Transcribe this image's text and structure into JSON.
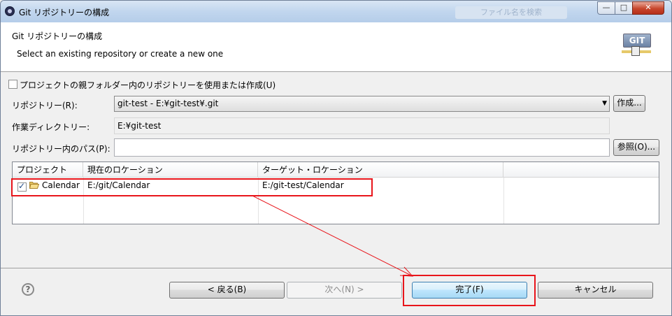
{
  "window": {
    "title": "Git リポジトリーの構成",
    "search_hint": "ファイル名を検索",
    "controls": {
      "minimize": "—",
      "maximize": "□",
      "close": "✕"
    }
  },
  "header": {
    "title": "Git リポジトリーの構成",
    "description": "Select an existing repository or create a new one",
    "logo_text": "GIT"
  },
  "options": {
    "use_parent_checkbox_label": "プロジェクトの親フォルダー内のリポジトリーを使用または作成(U)",
    "use_parent_checked": false
  },
  "form": {
    "repository_label": "リポジトリー(R):",
    "repository_value": "git-test - E:¥git-test¥.git",
    "create_button": "作成...",
    "workdir_label": "作業ディレクトリー:",
    "workdir_value": "E:¥git-test",
    "path_label": "リポジトリー内のパス(P):",
    "path_value": "",
    "browse_button": "参照(O)..."
  },
  "table": {
    "columns": [
      "プロジェクト",
      "現在のロケーション",
      "ターゲット・ロケーション",
      ""
    ],
    "rows": [
      {
        "checked": true,
        "project": "Calendar",
        "current": "E:/git/Calendar",
        "target": "E:/git-test/Calendar"
      }
    ]
  },
  "footer": {
    "help_icon": "?",
    "back_button": "< 戻る(B)",
    "next_button": "次へ(N) >",
    "finish_button": "完了(F)",
    "cancel_button": "キャンセル"
  },
  "annotation": {
    "color": "#e8151b"
  }
}
